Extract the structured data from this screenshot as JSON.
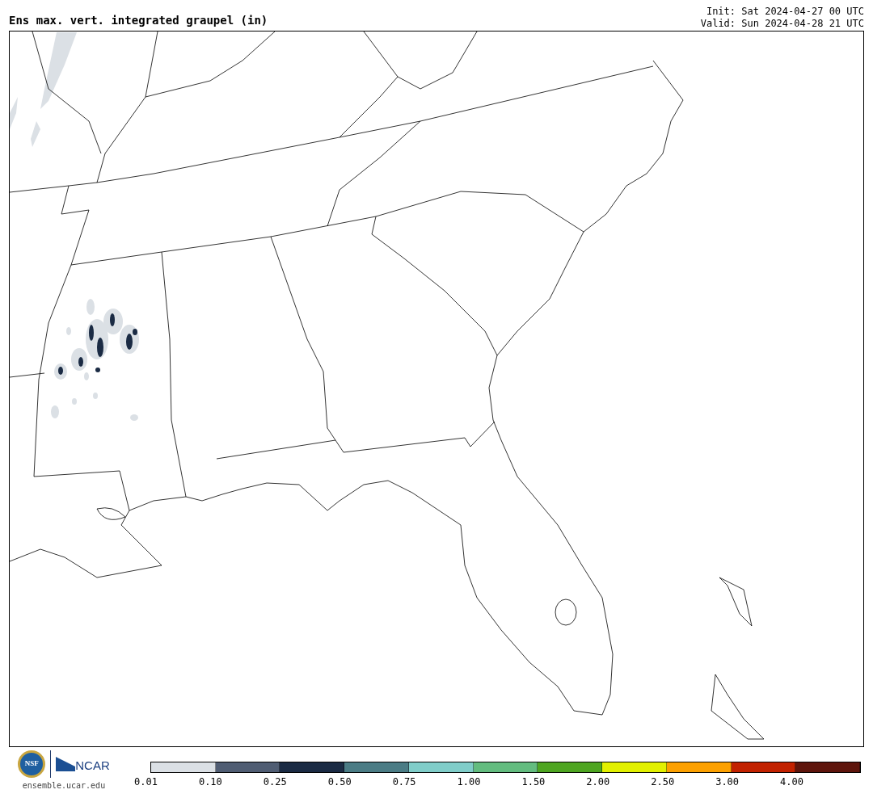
{
  "title": "Ens max. vert. integrated graupel (in)",
  "init": "Init: Sat 2024-04-27 00 UTC",
  "valid": "Valid: Sun 2024-04-28 21 UTC",
  "logos": {
    "nsf": "NSF",
    "ncar": "NCAR",
    "url": "ensemble.ucar.edu"
  },
  "colorbar": [
    {
      "color": "#dbe0e5",
      "label": "0.01"
    },
    {
      "color": "#505d73",
      "label": "0.10"
    },
    {
      "color": "#1b2b44",
      "label": "0.25"
    },
    {
      "color": "#4b7c85",
      "label": "0.50"
    },
    {
      "color": "#80cdc9",
      "label": "0.75"
    },
    {
      "color": "#63bc7f",
      "label": "1.00"
    },
    {
      "color": "#4ea521",
      "label": "1.50"
    },
    {
      "color": "#e2f000",
      "label": "2.00"
    },
    {
      "color": "#fca000",
      "label": "2.50"
    },
    {
      "color": "#c22200",
      "label": "3.00"
    },
    {
      "color": "#5e150c",
      "label": "4.00"
    }
  ]
}
